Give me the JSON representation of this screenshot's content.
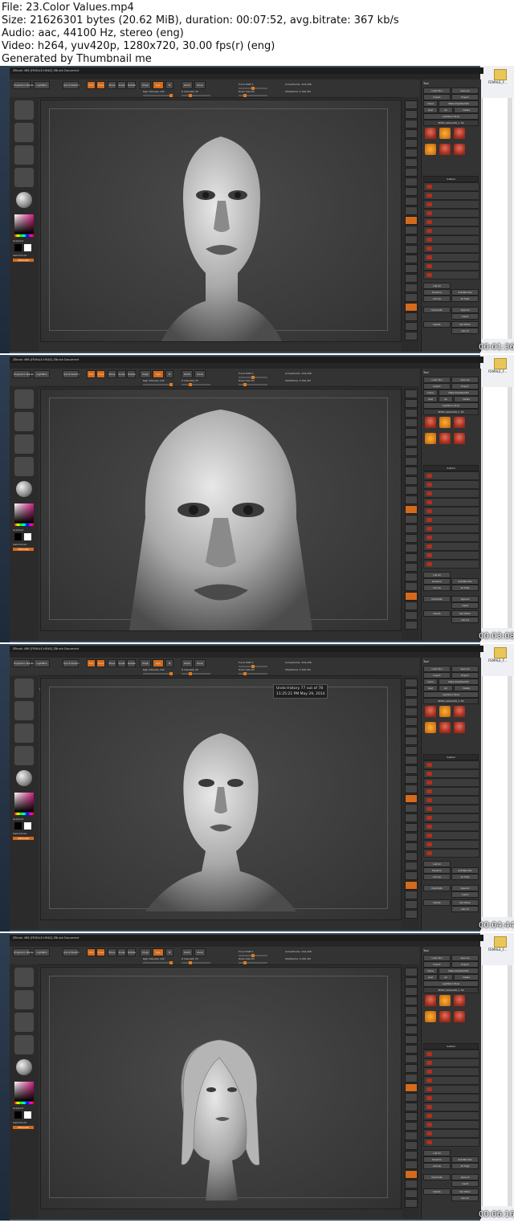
{
  "header": {
    "file_line": "File: 23.Color Values.mp4",
    "size_line": "Size: 21626301 bytes (20.62 MiB), duration: 00:07:52, avg.bitrate: 367 kb/s",
    "audio_line": "Audio: aac, 44100 Hz, stereo (eng)",
    "video_line": "Video: h264, yuv420p, 1280x720, 30.00 fps(r) (eng)",
    "generator_line": "Generated by Thumbnail me"
  },
  "desktop": {
    "folder_label": "FEMALE_F..."
  },
  "app": {
    "title": "ZBrush 4R6 [FEMALE-HEAD] ZBrush Document",
    "menus": [
      "Alpha",
      "Brush",
      "Color",
      "Document",
      "Draw",
      "Edit",
      "File",
      "Layer",
      "Light",
      "Macro",
      "Marker",
      "Material",
      "Movie",
      "Picker",
      "Preferences",
      "Render",
      "Stencil",
      "Stroke",
      "Texture",
      "Tool",
      "Transform",
      "Zplugin",
      "Zscript"
    ],
    "toolbar": {
      "projection_master": "Projection Master",
      "lightbox": "LightBox",
      "quick_sketch": "Quick Sketch",
      "edit": "Edit",
      "draw": "Draw",
      "move": "Move",
      "scale": "Scale",
      "rotate": "Rotate",
      "mrgb": "Mrgb",
      "rgb": "Rgb",
      "m": "M",
      "zadd": "Zadd",
      "zsub": "Zsub",
      "rgb_intensity": "Rgb Intensity 100",
      "z_intensity": "Z Intensity 25",
      "focal_shift": "Focal Shift 0",
      "draw_size": "Draw Size 64",
      "active_points": "ActivePoints: 344,298",
      "total_points": "TotalPoints: 5.561 Mil"
    },
    "left_shelf": {
      "gradient": "Gradient",
      "switch_color": "SwitchColor",
      "alternate": "Alternate"
    },
    "tool_panel": {
      "title": "Tool",
      "load_tool": "Load Tool",
      "save_as": "Save As",
      "import": "Import",
      "export": "Export",
      "clone": "Clone",
      "make_polymesh": "Make PolyMesh3D",
      "goz": "GoZ",
      "all": "All",
      "visible": "Visible",
      "lightbox_tools": "Lightbox>Tools",
      "current_tool": "PM3D_Sphere3D_1. 56",
      "subtool": "Subtool",
      "list_all": "List All",
      "rename": "Rename",
      "auto_reorder": "AutoReorder",
      "all_low": "All Low",
      "all_high": "All High",
      "duplicate": "Duplicate",
      "append": "Append",
      "insert": "Insert",
      "delete": "Delete",
      "del_other": "Del Other",
      "del_all": "Del All"
    }
  },
  "frames": [
    {
      "timecode": "00:01:36",
      "model": "head-front",
      "tooltip": null
    },
    {
      "timecode": "00:03:08",
      "model": "head-closeup",
      "tooltip": null
    },
    {
      "timecode": "00:04:44",
      "model": "head-far",
      "tooltip": {
        "line1": "Undo History 77 out of 78",
        "line2": "11:25:21 PM     May 29, 2014"
      },
      "undo_label": "Undo History 77 out of 78"
    },
    {
      "timecode": "00:06:16",
      "model": "head-hair",
      "tooltip": null
    }
  ]
}
